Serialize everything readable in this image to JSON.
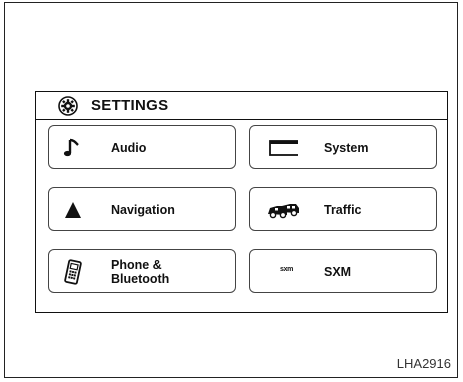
{
  "header": {
    "title": "SETTINGS"
  },
  "menu": {
    "audio": "Audio",
    "system": "System",
    "navigation": "Navigation",
    "traffic": "Traffic",
    "phone": "Phone &",
    "phone_line2": "Bluetooth",
    "sxm": "SXM",
    "sxm_logo_text": "sxm"
  },
  "figure_code": "LHA2916"
}
